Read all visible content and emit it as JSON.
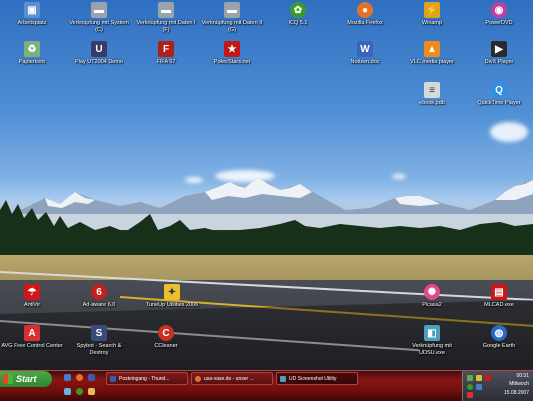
{
  "desktop_icons": [
    {
      "label": "Arbeitsplatz",
      "icon": "computer-icon",
      "color": "#5a8fd0"
    },
    {
      "label": "Verknüpfung mit System (C)",
      "icon": "drive-icon",
      "color": "#9aa3ad"
    },
    {
      "label": "Verknüpfung mit Daten I (F)",
      "icon": "drive-icon",
      "color": "#9aa3ad"
    },
    {
      "label": "Verknüpfung mit Daten II (G)",
      "icon": "drive-icon",
      "color": "#9aa3ad"
    },
    {
      "label": "ICQ 5.1",
      "icon": "icq-flower-icon",
      "color": "#3d9a2a"
    },
    {
      "label": "Mozilla Firefox",
      "icon": "firefox-icon",
      "color": "#e2722a"
    },
    {
      "label": "Winamp",
      "icon": "winamp-icon",
      "color": "#e0a020"
    },
    {
      "label": "PowerDVD",
      "icon": "powerdvd-icon",
      "color": "#c040a0"
    },
    {
      "label": "Papierkorb",
      "icon": "recycle-bin-icon",
      "color": "#7ab37a"
    },
    {
      "label": "Play UT2004 Demo",
      "icon": "ut2004-icon",
      "color": "#3a3a6a"
    },
    {
      "label": "FIFA 07",
      "icon": "fifa-icon",
      "color": "#b0201a"
    },
    {
      "label": "PokerStars.net",
      "icon": "pokerstars-icon",
      "color": "#c01818"
    },
    {
      "label": "Notizen.doc",
      "icon": "word-document-icon",
      "color": "#3a64b8"
    },
    {
      "label": "VLC media player",
      "icon": "vlc-cone-icon",
      "color": "#f08a18"
    },
    {
      "label": "DivX Player",
      "icon": "divx-icon",
      "color": "#2a2a2a"
    },
    {
      "label": "ebook.pdb",
      "icon": "file-icon",
      "color": "#d8d8d8"
    },
    {
      "label": "QuickTime Player",
      "icon": "quicktime-icon",
      "color": "#2f8fe0"
    },
    {
      "label": "AntiVir",
      "icon": "antivir-umbrella-icon",
      "color": "#d01818"
    },
    {
      "label": "Ad-aware 6.0",
      "icon": "adaware-icon",
      "color": "#c02020"
    },
    {
      "label": "TuneUp Utilities 2006",
      "icon": "tuneup-icon",
      "color": "#e8c030"
    },
    {
      "label": "Picasa2",
      "icon": "picasa-icon",
      "color": "#e04890"
    },
    {
      "label": "MLCAD.exe",
      "icon": "mlcad-icon",
      "color": "#c81818"
    },
    {
      "label": "AVG Free Control Center",
      "icon": "avg-icon",
      "color": "#d83030"
    },
    {
      "label": "Spybot - Search & Destroy",
      "icon": "spybot-icon",
      "color": "#3a4a7a"
    },
    {
      "label": "CCleaner",
      "icon": "ccleaner-icon",
      "color": "#c83020"
    },
    {
      "label": "Verknüpfung mit UDSU.exe",
      "icon": "udsu-icon",
      "color": "#4aa0c0"
    },
    {
      "label": "Google Earth",
      "icon": "google-earth-icon",
      "color": "#2a6ac8"
    }
  ],
  "taskbar": {
    "start_label": "Start",
    "buttons": [
      {
        "label": "Posteingang - Thund...",
        "icon": "thunderbird-icon",
        "color": "#3a5ab0"
      },
      {
        "label": "usa-vase.de - unser ...",
        "icon": "firefox-icon",
        "color": "#e2722a"
      },
      {
        "label": "UD Screenshot Utility",
        "icon": "udsu-icon",
        "color": "#4aa0c0"
      }
    ],
    "clock_time": "00:31",
    "clock_day": "Mittwoch",
    "clock_date": "15.08.2007"
  },
  "colors": {
    "taskbar": "#8a1414",
    "start": "#3a983a"
  }
}
